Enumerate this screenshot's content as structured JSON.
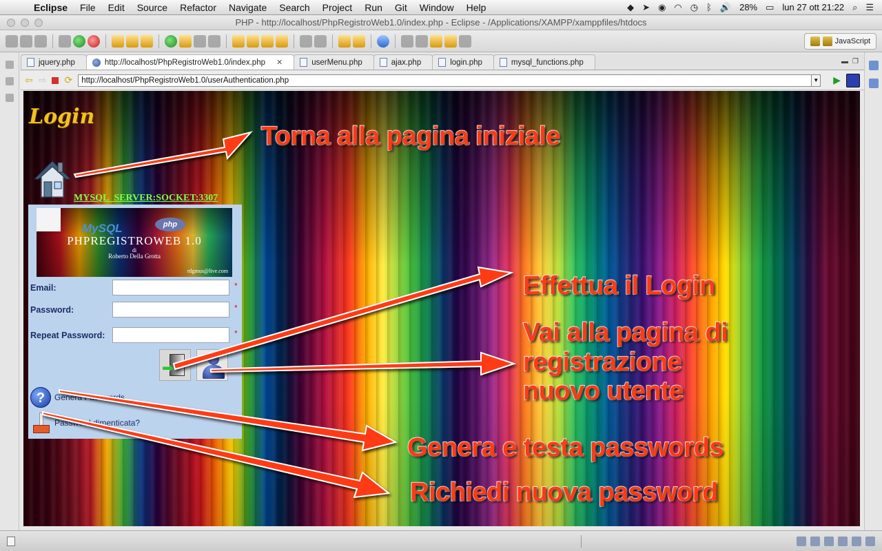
{
  "menubar": {
    "app": "Eclipse",
    "items": [
      "File",
      "Edit",
      "Source",
      "Refactor",
      "Navigate",
      "Search",
      "Project",
      "Run",
      "Git",
      "Window",
      "Help"
    ],
    "battery": "28%",
    "datetime": "lun 27 ott  21:22"
  },
  "window": {
    "title": "PHP - http://localhost/PhpRegistroWeb1.0/index.php - Eclipse - /Applications/XAMPP/xamppfiles/htdocs",
    "perspective": "JavaScript"
  },
  "tabs": [
    {
      "label": "jquery.php",
      "kind": "file"
    },
    {
      "label": "http://localhost/PhpRegistroWeb1.0/index.php",
      "kind": "web",
      "active": true
    },
    {
      "label": "userMenu.php",
      "kind": "file"
    },
    {
      "label": "ajax.php",
      "kind": "file"
    },
    {
      "label": "login.php",
      "kind": "file"
    },
    {
      "label": "mysql_functions.php",
      "kind": "file"
    }
  ],
  "browser": {
    "url": "http://localhost/PhpRegistroWeb1.0/userAuthentication.php"
  },
  "page": {
    "title": "Login",
    "server_link": "MYSQL_SERVER:SOCKET:3307",
    "banner": {
      "mysql": "MySQL",
      "php": "php",
      "title": "PHPREGISTROWEB 1.0",
      "di": "di",
      "author": "Roberto Della Grotta",
      "email": "rdgmus@live.com"
    },
    "form": {
      "email_label": "Email:",
      "password_label": "Password:",
      "repeat_label": "Repeat Password:",
      "required_mark": "*",
      "email_value": "",
      "password_value": "",
      "repeat_value": ""
    },
    "links": {
      "generate": "Genera Passwords",
      "forgot": "Password dimenticata?"
    },
    "callouts": {
      "home": "Torna alla pagina iniziale",
      "login": "Effettua il Login",
      "register_1": "Vai alla pagina di",
      "register_2": "registrazione",
      "register_3": "nuovo utente",
      "generate": "Genera e testa passwords",
      "forgot": "Richiedi nuova password"
    },
    "accent_color": "#ff3a14"
  }
}
